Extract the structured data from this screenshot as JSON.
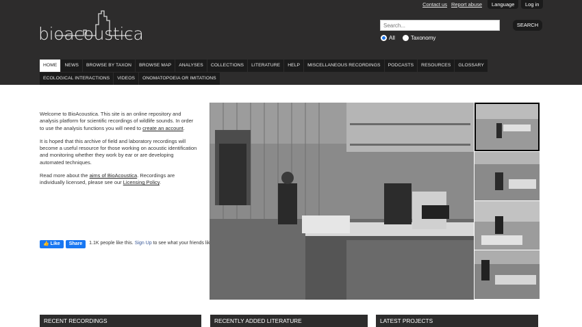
{
  "toplinks": {
    "contact": "Contact us",
    "report": "Report abuse",
    "language": "Language",
    "login": "Log in"
  },
  "logo": {
    "text": "bioacoustica"
  },
  "search": {
    "placeholder": "Search...",
    "button": "SEARCH",
    "options": [
      "All",
      "Taxonomy"
    ],
    "selected": "All"
  },
  "nav": {
    "row1": [
      "HOME",
      "NEWS",
      "BROWSE BY TAXON",
      "BROWSE MAP",
      "ANALYSES",
      "COLLECTIONS",
      "LITERATURE",
      "HELP",
      "MISCELLANEOUS RECORDINGS",
      "PODCASTS",
      "RESOURCES",
      "GLOSSARY"
    ],
    "row2": [
      "ECOLOGICAL INTERACTIONS",
      "VIDEOS",
      "ONOMATOPOEIA OR IMITATIONS"
    ],
    "active": "HOME"
  },
  "intro": {
    "p1_text": "Welcome to BioAcoustica. This site is an online repository and analysis platform for scientific recordings of wildlife sounds. In order to use the analysis functions you will need to",
    "p1_link": "create an account",
    "p1_end": ".",
    "p2": "It is hoped that this archive of field and laboratory recordings will become a useful resource for those working on acoustic identification and monitoring whether they work by ear or are developing automated techniques.",
    "p3_text": "Read more about the",
    "p3_link1": "aims of BioAcoustica",
    "p3_mid": ". Recordings are individually licensed, please see our",
    "p3_link2": "Licensing Policy",
    "p3_end": "."
  },
  "facebook": {
    "like": "Like",
    "share": "Share",
    "count_text": "1.1K people like this.",
    "signup": "Sign Up",
    "rest": "to see what your friends like."
  },
  "sections": [
    "RECENT RECORDINGS",
    "RECENTLY ADDED LITERATURE",
    "LATEST PROJECTS"
  ]
}
